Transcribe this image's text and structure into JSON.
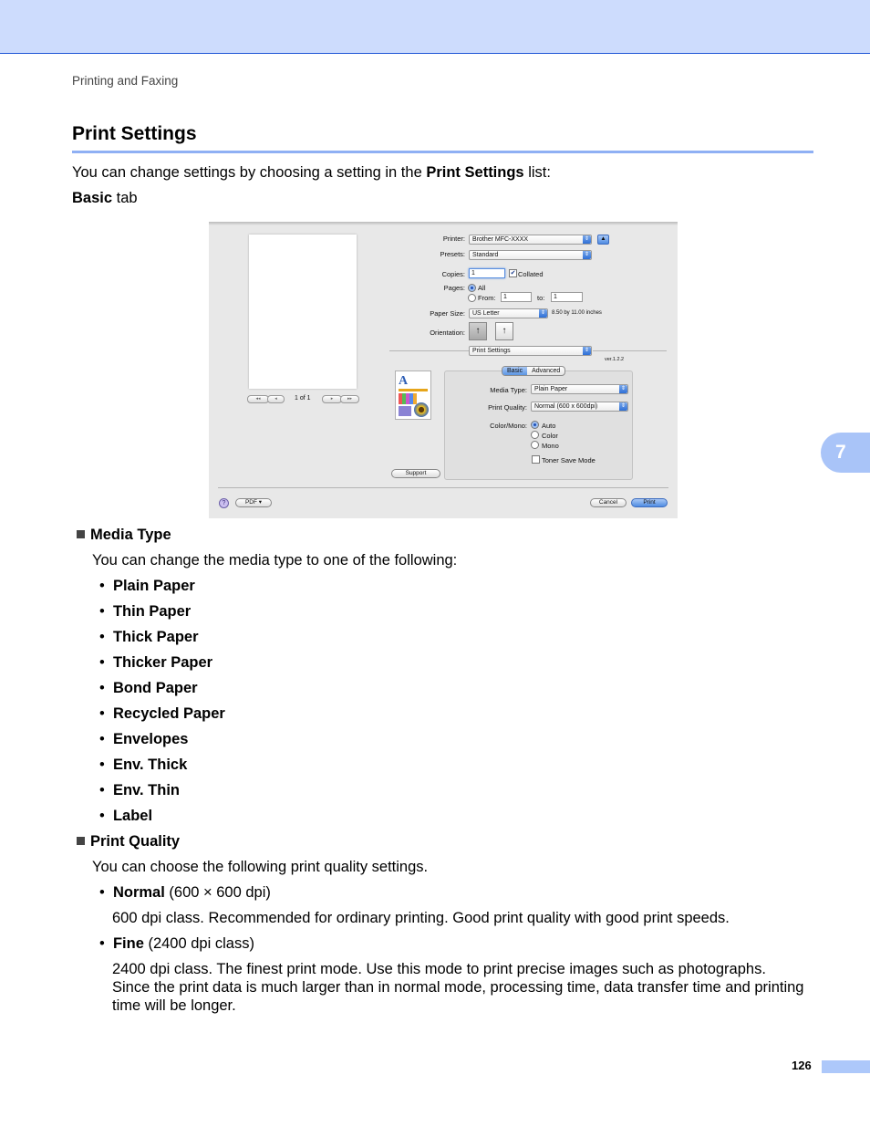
{
  "header": {
    "running_head": "Printing and Faxing"
  },
  "section": {
    "title": "Print Settings",
    "intro_pre": "You can change settings by choosing a setting in the ",
    "intro_bold": "Print Settings",
    "intro_post": " list:",
    "tab_label_bold": "Basic",
    "tab_label_post": " tab"
  },
  "dialog": {
    "preview": {
      "page_counter": "1 of 1",
      "nav_first": "◂◂",
      "nav_prev": "◂",
      "nav_next": "▸",
      "nav_last": "▸▸"
    },
    "printer": {
      "label": "Printer:",
      "value": "Brother MFC-XXXX"
    },
    "presets": {
      "label": "Presets:",
      "value": "Standard"
    },
    "copies": {
      "label": "Copies:",
      "value": "1",
      "collated_label": "Collated",
      "collated_checked": true
    },
    "pages": {
      "label": "Pages:",
      "all_label": "All",
      "from_label": "From:",
      "from_value": "1",
      "to_label": "to:",
      "to_value": "1",
      "selected": "All"
    },
    "paper_size": {
      "label": "Paper Size:",
      "value": "US Letter",
      "dimensions": "8.50 by 11.00 inches"
    },
    "orientation": {
      "label": "Orientation:",
      "selected": "portrait"
    },
    "panel_select": {
      "value": "Print Settings"
    },
    "version": "ver.1.2.2",
    "tabs": [
      {
        "label": "Basic",
        "selected": true
      },
      {
        "label": "Advanced",
        "selected": false
      }
    ],
    "media_type": {
      "label": "Media Type:",
      "value": "Plain Paper"
    },
    "print_quality": {
      "label": "Print Quality:",
      "value": "Normal (600 x 600dpi)"
    },
    "color_mono": {
      "label": "Color/Mono:",
      "options": [
        "Auto",
        "Color",
        "Mono"
      ],
      "selected": "Auto"
    },
    "toner_save": {
      "label": "Toner Save Mode",
      "checked": false
    },
    "support_button": "Support",
    "help_button": "?",
    "pdf_button": "PDF ▾",
    "cancel_button": "Cancel",
    "print_button": "Print"
  },
  "media_type_section": {
    "heading": "Media Type",
    "description": "You can change the media type to one of the following:",
    "items": [
      "Plain Paper",
      "Thin Paper",
      "Thick Paper",
      "Thicker Paper",
      "Bond Paper",
      "Recycled Paper",
      "Envelopes",
      "Env. Thick",
      "Env. Thin",
      "Label"
    ]
  },
  "print_quality_section": {
    "heading": "Print Quality",
    "description": "You can choose the following print quality settings.",
    "normal": {
      "name": "Normal",
      "spec": " (600 × 600 dpi)",
      "desc": "600 dpi class. Recommended for ordinary printing. Good print quality with good print speeds."
    },
    "fine": {
      "name": "Fine",
      "spec": " (2400 dpi class)",
      "desc_lines": [
        "2400 dpi class. The finest print mode. Use this mode to print precise images such as photographs.",
        "Since the print data is much larger than in normal mode, processing time, data transfer time and printing",
        "time will be longer."
      ]
    }
  },
  "chapter_tab": "7",
  "footer": {
    "page_number": "126"
  },
  "colors": {
    "band": "#cddcfd",
    "band_rule": "#1f56d6",
    "title_rule": "#8fb0f4",
    "chapter_tab": "#a9c4f8",
    "page_bar": "#adc8fa"
  }
}
